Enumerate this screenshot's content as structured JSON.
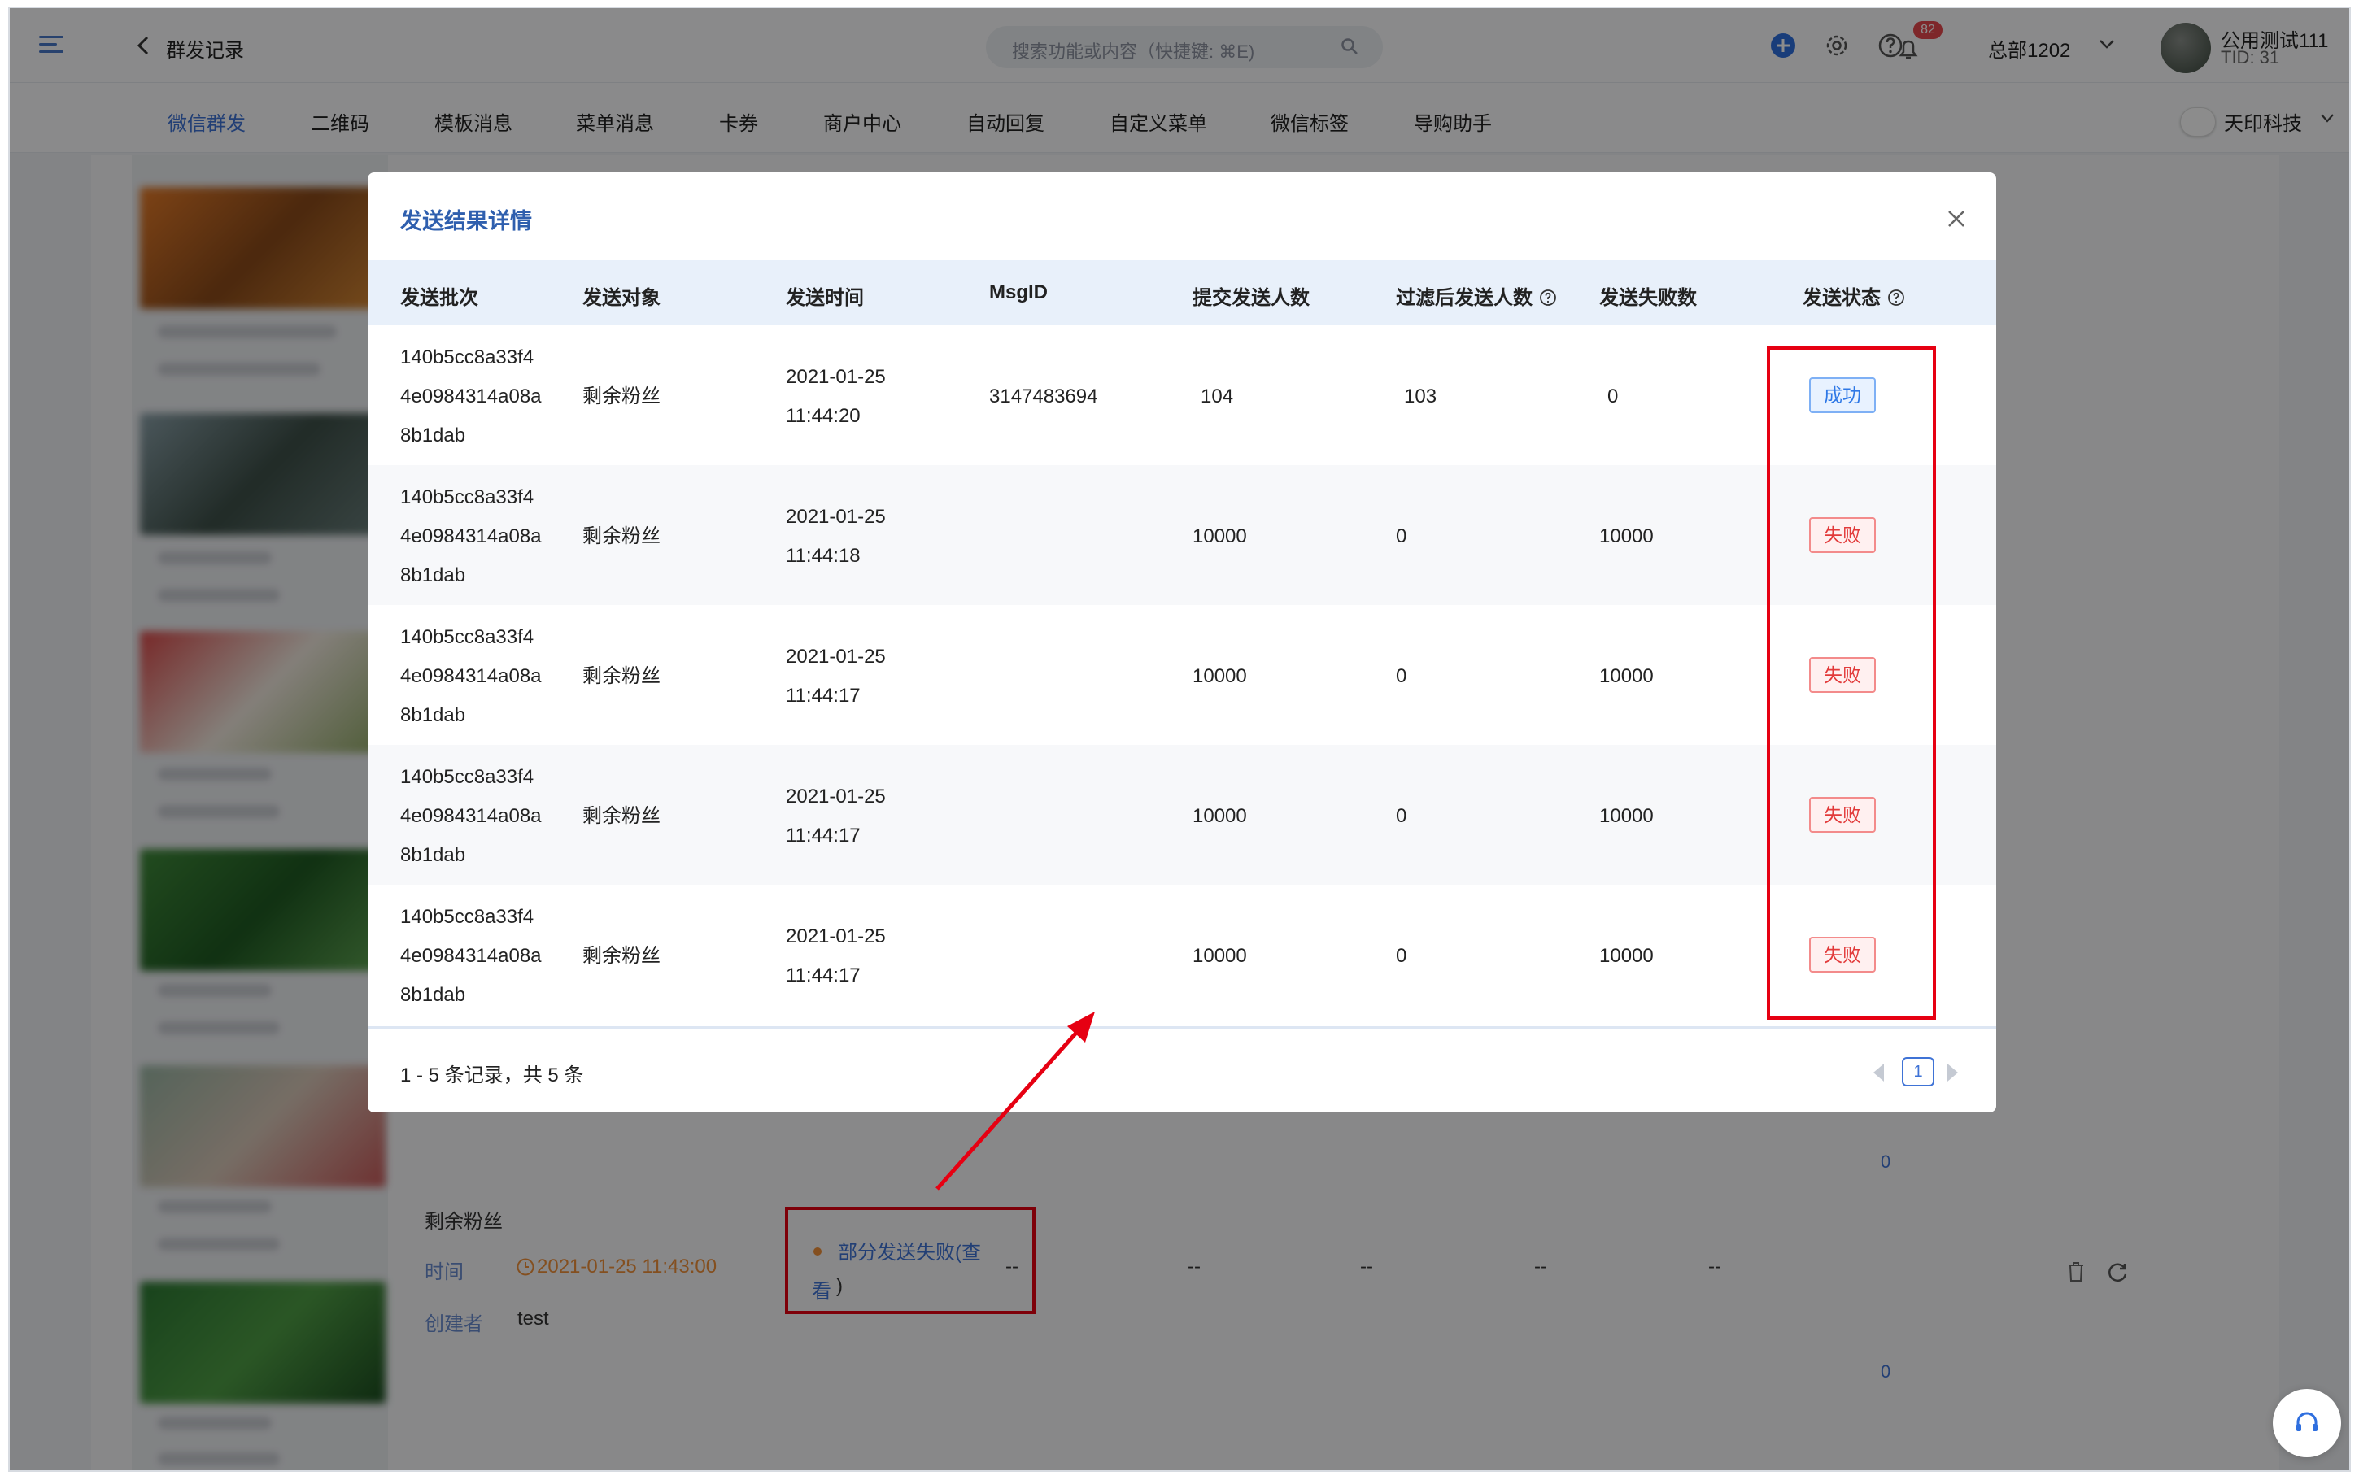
{
  "topbar": {
    "title": "群发记录",
    "search_placeholder": "搜索功能或内容（快捷键: ⌘E)",
    "notification_count": "82",
    "department": "总部1202",
    "user_name": "公用测试111",
    "user_tid": "TID: 31"
  },
  "nav": {
    "tabs": [
      "微信群发",
      "二维码",
      "模板消息",
      "菜单消息",
      "卡券",
      "商户中心",
      "自动回复",
      "自定义菜单",
      "微信标签",
      "导购助手"
    ],
    "active_tab": 0,
    "company": "天印科技"
  },
  "background_row": {
    "target": "剩余粉丝",
    "time_label": "时间",
    "time_value": "2021-01-25 11:43:00",
    "creator_label": "创建者",
    "creator_value": "test",
    "status_link": "部分发送失败(查",
    "status_link_cont": "看",
    "status_paren": ")",
    "placeholders": [
      "--",
      "--",
      "--",
      "--",
      "--"
    ],
    "zero_top": "0",
    "zero_bottom": "0"
  },
  "modal": {
    "title": "发送结果详情",
    "columns": [
      "发送批次",
      "发送对象",
      "发送时间",
      "MsgID",
      "提交发送人数",
      "过滤后发送人数",
      "发送失败数",
      "发送状态"
    ],
    "rows": [
      {
        "batch1": "140b5cc8a33f4",
        "batch2": "4e0984314a08a",
        "batch3": "8b1dab",
        "target": "剩余粉丝",
        "date": "2021-01-25",
        "time": "11:44:20",
        "msgid": "3147483694",
        "submitted": "104",
        "filtered": "103",
        "failed": "0",
        "status": "成功"
      },
      {
        "batch1": "140b5cc8a33f4",
        "batch2": "4e0984314a08a",
        "batch3": "8b1dab",
        "target": "剩余粉丝",
        "date": "2021-01-25",
        "time": "11:44:18",
        "msgid": "",
        "submitted": "10000",
        "filtered": "0",
        "failed": "10000",
        "status": "失败"
      },
      {
        "batch1": "140b5cc8a33f4",
        "batch2": "4e0984314a08a",
        "batch3": "8b1dab",
        "target": "剩余粉丝",
        "date": "2021-01-25",
        "time": "11:44:17",
        "msgid": "",
        "submitted": "10000",
        "filtered": "0",
        "failed": "10000",
        "status": "失败"
      },
      {
        "batch1": "140b5cc8a33f4",
        "batch2": "4e0984314a08a",
        "batch3": "8b1dab",
        "target": "剩余粉丝",
        "date": "2021-01-25",
        "time": "11:44:17",
        "msgid": "",
        "submitted": "10000",
        "filtered": "0",
        "failed": "10000",
        "status": "失败"
      },
      {
        "batch1": "140b5cc8a33f4",
        "batch2": "4e0984314a08a",
        "batch3": "8b1dab",
        "target": "剩余粉丝",
        "date": "2021-01-25",
        "time": "11:44:17",
        "msgid": "",
        "submitted": "10000",
        "filtered": "0",
        "failed": "10000",
        "status": "失败"
      }
    ],
    "pagination_summary": "1 - 5 条记录，共 5 条",
    "current_page": "1"
  },
  "colors": {
    "accent": "#3f73d6",
    "annotation_red": "#e60012",
    "success": "#2e78e6",
    "fail": "#e23a3a"
  }
}
